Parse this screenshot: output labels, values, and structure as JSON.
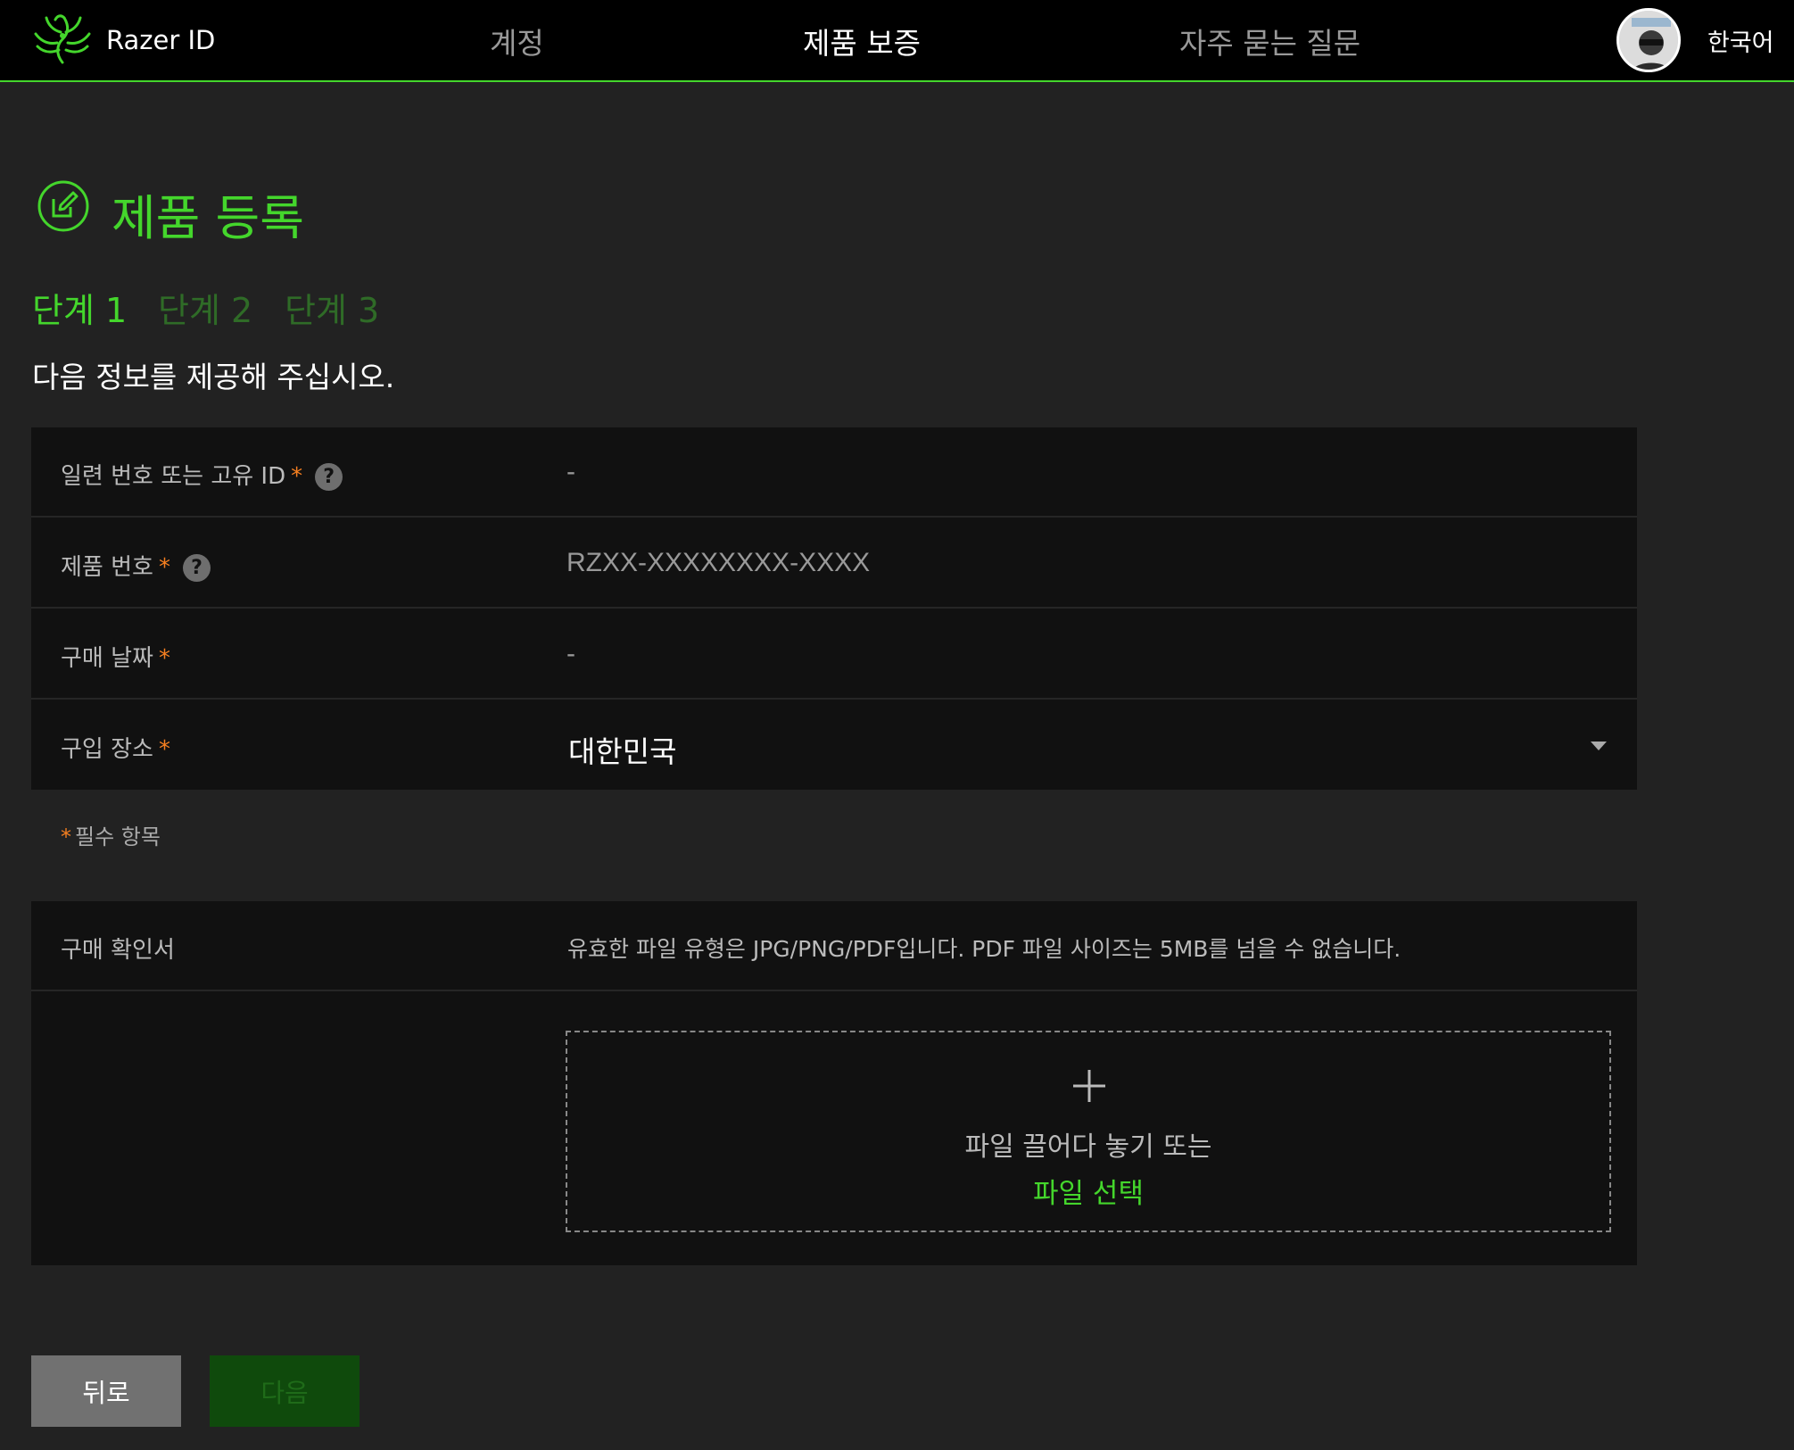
{
  "header": {
    "brand": "Razer ID",
    "nav": [
      {
        "label": "계정",
        "active": false
      },
      {
        "label": "제품 보증",
        "active": true
      },
      {
        "label": "자주 묻는 질문",
        "active": false
      }
    ],
    "language": "한국어"
  },
  "main": {
    "title": "제품 등록",
    "steps": [
      "단계 1",
      "단계 2",
      "단계 3"
    ],
    "active_step": 1,
    "instruction": "다음 정보를 제공해 주십시오."
  },
  "form": {
    "serial": {
      "label": "일련 번호 또는 고유 ID",
      "required_mark": "*",
      "placeholder": "-"
    },
    "product": {
      "label": "제품 번호",
      "required_mark": "*",
      "placeholder": "RZXX-XXXXXXXX-XXXX"
    },
    "date": {
      "label": "구매 날짜",
      "required_mark": "*",
      "placeholder": "-"
    },
    "place": {
      "label": "구입 장소",
      "required_mark": "*",
      "value": "대한민국"
    },
    "required_note_mark": "*",
    "required_note": "필수 항목"
  },
  "upload": {
    "label": "구매 확인서",
    "hint": "유효한 파일 유형은 JPG/PNG/PDF입니다. PDF 파일 사이즈는 5MB를 넘을 수 없습니다.",
    "drop_text": "파일 끌어다 놓기 또는",
    "choose_link": "파일 선택"
  },
  "buttons": {
    "back": "뒤로",
    "next": "다음"
  },
  "help_glyph": "?",
  "colors": {
    "accent": "#44d62c",
    "required": "#f57f20",
    "background": "#222222",
    "panel": "#111111",
    "topbar": "#000000"
  }
}
